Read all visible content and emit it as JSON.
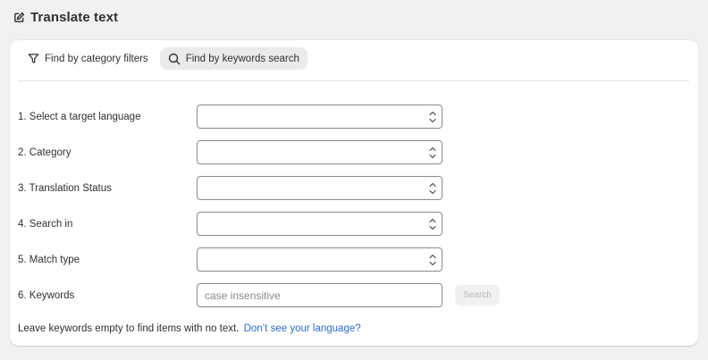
{
  "header": {
    "title": "Translate text"
  },
  "tabs": [
    {
      "label": "Find by category filters",
      "icon": "filter-icon",
      "active": false
    },
    {
      "label": "Find by keywords search",
      "icon": "search-icon",
      "active": true
    }
  ],
  "form": {
    "target_language": {
      "label": "1. Select a target language",
      "value": ""
    },
    "category": {
      "label": "2. Category",
      "value": ""
    },
    "translation_status": {
      "label": "3. Translation Status",
      "value": ""
    },
    "search_in": {
      "label": "4. Search in",
      "value": ""
    },
    "match_type": {
      "label": "5. Match type",
      "value": ""
    },
    "keywords": {
      "label": "6. Keywords",
      "value": "",
      "placeholder": "case insensitive"
    },
    "search_button": "Search"
  },
  "help": {
    "text": "Leave keywords empty to find items with no text.",
    "link": "Don’t see your language?"
  },
  "colors": {
    "link": "#2c6ecb",
    "page_bg": "#f1f1f1",
    "card_bg": "#ffffff"
  }
}
